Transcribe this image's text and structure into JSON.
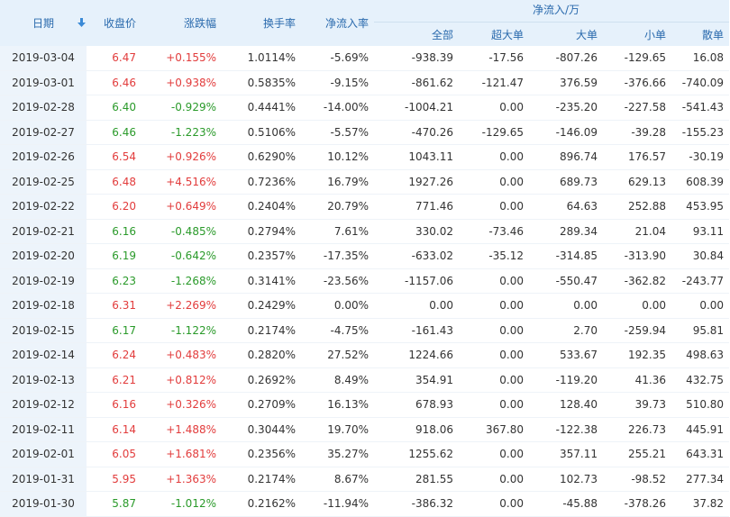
{
  "header": {
    "date": "日期",
    "close": "收盘价",
    "change": "涨跌幅",
    "turnover": "换手率",
    "net_inflow_rate": "净流入率",
    "net_inflow_group": "净流入/万",
    "all": "全部",
    "super_large": "超大单",
    "large": "大单",
    "small": "小单",
    "retail": "散单",
    "sort_icon": "arrow-down-icon"
  },
  "colors": {
    "up": "#e23c3c",
    "down": "#2a9a2a",
    "header_bg": "#e6f1fb",
    "header_text": "#2a6aad",
    "date_bg": "#edf4fb"
  },
  "rows": [
    {
      "date": "2019-03-04",
      "close": "6.47",
      "change": "+0.155%",
      "dir": "up",
      "turnover": "1.0114%",
      "rate": "-5.69%",
      "all": "-938.39",
      "super": "-17.56",
      "large": "-807.26",
      "small": "-129.65",
      "retail": "16.08"
    },
    {
      "date": "2019-03-01",
      "close": "6.46",
      "change": "+0.938%",
      "dir": "up",
      "turnover": "0.5835%",
      "rate": "-9.15%",
      "all": "-861.62",
      "super": "-121.47",
      "large": "376.59",
      "small": "-376.66",
      "retail": "-740.09"
    },
    {
      "date": "2019-02-28",
      "close": "6.40",
      "change": "-0.929%",
      "dir": "down",
      "turnover": "0.4441%",
      "rate": "-14.00%",
      "all": "-1004.21",
      "super": "0.00",
      "large": "-235.20",
      "small": "-227.58",
      "retail": "-541.43"
    },
    {
      "date": "2019-02-27",
      "close": "6.46",
      "change": "-1.223%",
      "dir": "down",
      "turnover": "0.5106%",
      "rate": "-5.57%",
      "all": "-470.26",
      "super": "-129.65",
      "large": "-146.09",
      "small": "-39.28",
      "retail": "-155.23"
    },
    {
      "date": "2019-02-26",
      "close": "6.54",
      "change": "+0.926%",
      "dir": "up",
      "turnover": "0.6290%",
      "rate": "10.12%",
      "all": "1043.11",
      "super": "0.00",
      "large": "896.74",
      "small": "176.57",
      "retail": "-30.19"
    },
    {
      "date": "2019-02-25",
      "close": "6.48",
      "change": "+4.516%",
      "dir": "up",
      "turnover": "0.7236%",
      "rate": "16.79%",
      "all": "1927.26",
      "super": "0.00",
      "large": "689.73",
      "small": "629.13",
      "retail": "608.39"
    },
    {
      "date": "2019-02-22",
      "close": "6.20",
      "change": "+0.649%",
      "dir": "up",
      "turnover": "0.2404%",
      "rate": "20.79%",
      "all": "771.46",
      "super": "0.00",
      "large": "64.63",
      "small": "252.88",
      "retail": "453.95"
    },
    {
      "date": "2019-02-21",
      "close": "6.16",
      "change": "-0.485%",
      "dir": "down",
      "turnover": "0.2794%",
      "rate": "7.61%",
      "all": "330.02",
      "super": "-73.46",
      "large": "289.34",
      "small": "21.04",
      "retail": "93.11"
    },
    {
      "date": "2019-02-20",
      "close": "6.19",
      "change": "-0.642%",
      "dir": "down",
      "turnover": "0.2357%",
      "rate": "-17.35%",
      "all": "-633.02",
      "super": "-35.12",
      "large": "-314.85",
      "small": "-313.90",
      "retail": "30.84"
    },
    {
      "date": "2019-02-19",
      "close": "6.23",
      "change": "-1.268%",
      "dir": "down",
      "turnover": "0.3141%",
      "rate": "-23.56%",
      "all": "-1157.06",
      "super": "0.00",
      "large": "-550.47",
      "small": "-362.82",
      "retail": "-243.77"
    },
    {
      "date": "2019-02-18",
      "close": "6.31",
      "change": "+2.269%",
      "dir": "up",
      "turnover": "0.2429%",
      "rate": "0.00%",
      "all": "0.00",
      "super": "0.00",
      "large": "0.00",
      "small": "0.00",
      "retail": "0.00"
    },
    {
      "date": "2019-02-15",
      "close": "6.17",
      "change": "-1.122%",
      "dir": "down",
      "turnover": "0.2174%",
      "rate": "-4.75%",
      "all": "-161.43",
      "super": "0.00",
      "large": "2.70",
      "small": "-259.94",
      "retail": "95.81"
    },
    {
      "date": "2019-02-14",
      "close": "6.24",
      "change": "+0.483%",
      "dir": "up",
      "turnover": "0.2820%",
      "rate": "27.52%",
      "all": "1224.66",
      "super": "0.00",
      "large": "533.67",
      "small": "192.35",
      "retail": "498.63"
    },
    {
      "date": "2019-02-13",
      "close": "6.21",
      "change": "+0.812%",
      "dir": "up",
      "turnover": "0.2692%",
      "rate": "8.49%",
      "all": "354.91",
      "super": "0.00",
      "large": "-119.20",
      "small": "41.36",
      "retail": "432.75"
    },
    {
      "date": "2019-02-12",
      "close": "6.16",
      "change": "+0.326%",
      "dir": "up",
      "turnover": "0.2709%",
      "rate": "16.13%",
      "all": "678.93",
      "super": "0.00",
      "large": "128.40",
      "small": "39.73",
      "retail": "510.80"
    },
    {
      "date": "2019-02-11",
      "close": "6.14",
      "change": "+1.488%",
      "dir": "up",
      "turnover": "0.3044%",
      "rate": "19.70%",
      "all": "918.06",
      "super": "367.80",
      "large": "-122.38",
      "small": "226.73",
      "retail": "445.91"
    },
    {
      "date": "2019-02-01",
      "close": "6.05",
      "change": "+1.681%",
      "dir": "up",
      "turnover": "0.2356%",
      "rate": "35.27%",
      "all": "1255.62",
      "super": "0.00",
      "large": "357.11",
      "small": "255.21",
      "retail": "643.31"
    },
    {
      "date": "2019-01-31",
      "close": "5.95",
      "change": "+1.363%",
      "dir": "up",
      "turnover": "0.2174%",
      "rate": "8.67%",
      "all": "281.55",
      "super": "0.00",
      "large": "102.73",
      "small": "-98.52",
      "retail": "277.34"
    },
    {
      "date": "2019-01-30",
      "close": "5.87",
      "change": "-1.012%",
      "dir": "down",
      "turnover": "0.2162%",
      "rate": "-11.94%",
      "all": "-386.32",
      "super": "0.00",
      "large": "-45.88",
      "small": "-378.26",
      "retail": "37.82"
    }
  ]
}
